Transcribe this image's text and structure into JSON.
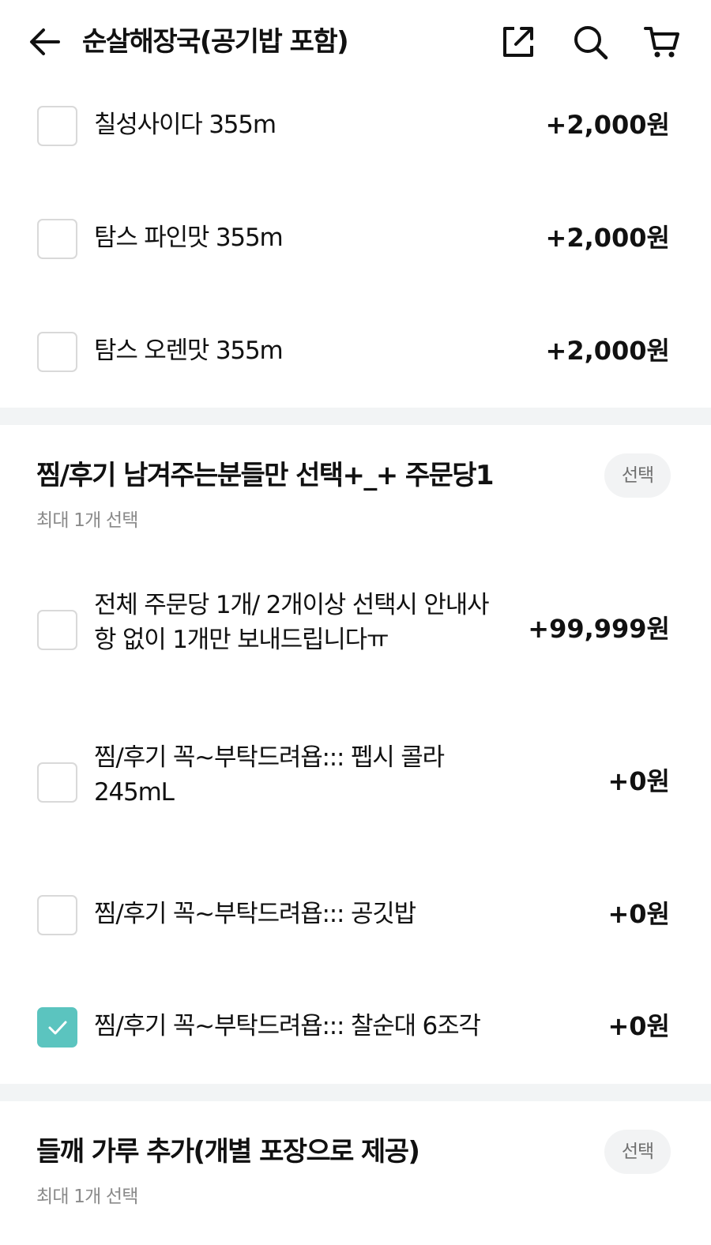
{
  "header": {
    "title": "순살해장국(공기밥 포함)",
    "icons": [
      "arrow-left-icon",
      "share-icon",
      "search-icon",
      "cart-icon"
    ]
  },
  "drink_options": [
    {
      "label": "칠성사이다 355m",
      "price": "+2,000원",
      "checked": false
    },
    {
      "label": "탐스 파인맛 355m",
      "price": "+2,000원",
      "checked": false
    },
    {
      "label": "탐스 오렌맛 355m",
      "price": "+2,000원",
      "checked": false
    }
  ],
  "review_group": {
    "title": "찜/후기 남겨주는분들만 선택+_+ 주문당1",
    "badge": "선택",
    "subtitle": "최대 1개 선택",
    "options": [
      {
        "label": "전체 주문당 1개/ 2개이상 선택시 안내사항 없이 1개만 보내드립니다ㅠ",
        "price": "+99,999원",
        "checked": false
      },
      {
        "label": "찜/후기 꼭~부탁드려욥::: 펩시 콜라 245mL",
        "price": "+0원",
        "checked": false
      },
      {
        "label": "찜/후기 꼭~부탁드려욥::: 공깃밥",
        "price": "+0원",
        "checked": false
      },
      {
        "label": "찜/후기 꼭~부탁드려욥::: 찰순대 6조각",
        "price": "+0원",
        "checked": true
      }
    ]
  },
  "perilla_group": {
    "title": "들깨 가루 추가(개별 포장으로 제공)",
    "badge": "선택",
    "subtitle": "최대 1개 선택"
  },
  "colors": {
    "accent_check": "#5bc4bf",
    "divider": "#f2f4f5",
    "checkbox_border": "#d9d9d9",
    "subtle_text": "#8a8a8a"
  }
}
